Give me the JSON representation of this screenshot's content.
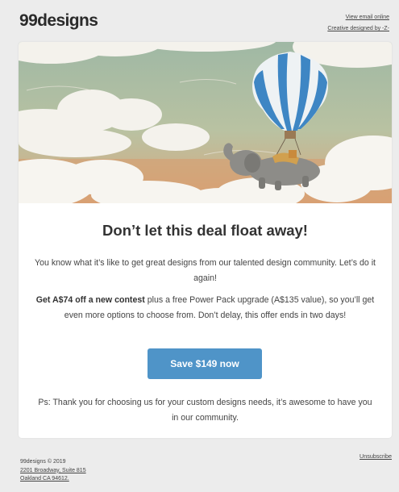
{
  "header": {
    "logo": "99designs",
    "view_email_online": "View email online",
    "credit": "Creative designed by -Z-"
  },
  "hero": {
    "illustration": "elephant-with-hot-air-balloon-in-clouds"
  },
  "content": {
    "headline": "Don’t let this deal float away!",
    "para1": "You know what it’s like to get great designs from our talented design community. Let’s do it again!",
    "para2_bold": "Get A$74 off a new contest",
    "para2_rest": " plus a free Power Pack upgrade (A$135 value), so you’ll get even more options to choose from. Don’t delay, this offer ends in two days!",
    "cta_label": "Save $149 now",
    "ps": "Ps: Thank you for choosing us for your custom designs needs, it’s awesome to have you in our community."
  },
  "footer": {
    "copyright": "99designs © 2019",
    "address_line1": "2201 Broadway, Suite 815",
    "address_line2": "Oakland CA 94612.",
    "unsubscribe": "Unsubscribe"
  },
  "colors": {
    "cta": "#4f94c8",
    "background": "#ececec",
    "card": "#ffffff"
  }
}
